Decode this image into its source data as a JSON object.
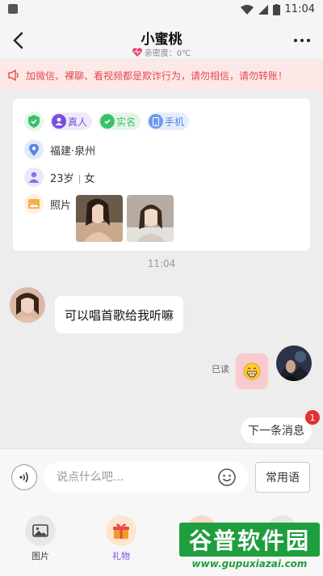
{
  "status_bar": {
    "time": "11:04"
  },
  "header": {
    "title": "小蜜桃",
    "intimacy": "亲密度：0℃"
  },
  "warning": {
    "text": "加微信、裸聊、看视频都是欺诈行为，请勿相信，请勿转账！"
  },
  "profile": {
    "badges": [
      "真人",
      "实名",
      "手机"
    ],
    "location": "福建·泉州",
    "age": "23岁",
    "gender": "女",
    "photos_label": "照片"
  },
  "chat": {
    "timestamp": "11:04",
    "incoming_message": "可以唱首歌给我听嘛",
    "read_status": "已读",
    "outgoing_emoji": "emoji-grin-icon"
  },
  "next_message": {
    "label": "下一条消息",
    "badge": "1"
  },
  "input": {
    "placeholder": "说点什么吧...",
    "phrase_button": "常用语"
  },
  "toolbar": [
    {
      "label": "图片",
      "icon": "image-icon"
    },
    {
      "label": "礼物",
      "icon": "gift-icon"
    },
    {
      "label": "",
      "icon": "video-icon"
    },
    {
      "label": "",
      "icon": "plus-icon"
    }
  ],
  "watermark": {
    "main": "谷普软件园",
    "url": "www.gupuxiazai.com"
  },
  "colors": {
    "accent": "#7a4ee0",
    "warning": "#e24b4b",
    "green": "#3cbf6b",
    "bubble_out": "#f9c9ce"
  }
}
